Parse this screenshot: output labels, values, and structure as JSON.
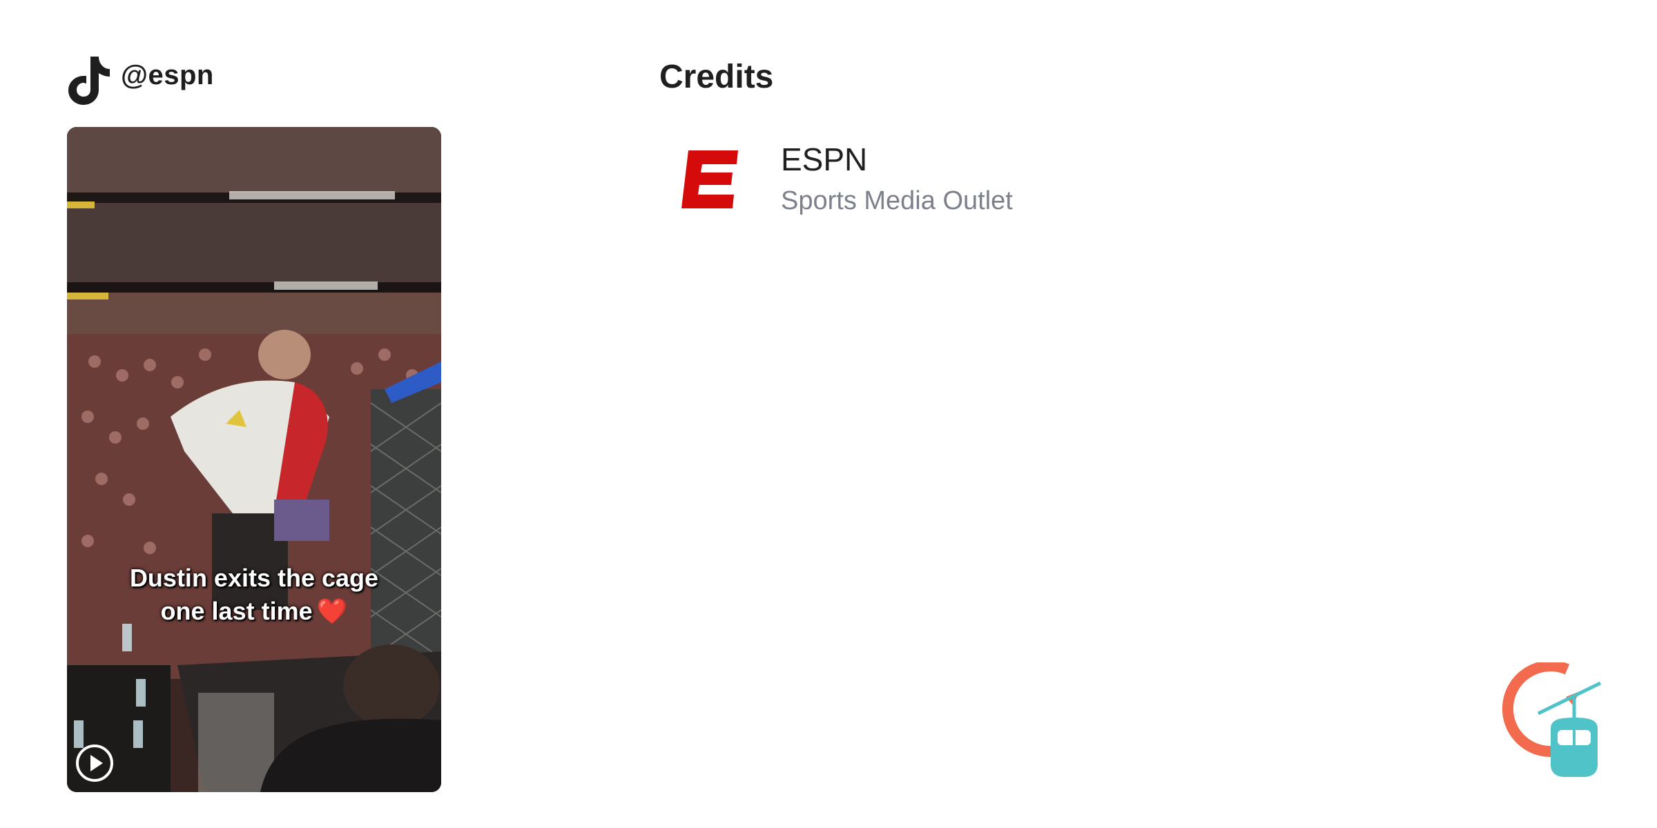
{
  "post": {
    "platform_icon": "tiktok-icon",
    "handle": "@espn",
    "video": {
      "caption_line1": "Dustin exits the cage",
      "caption_line2": "one last time",
      "caption_emoji": "❤️",
      "play_icon": "play-icon"
    }
  },
  "credits": {
    "title": "Credits",
    "items": [
      {
        "name": "ESPN",
        "subtitle": "Sports Media Outlet",
        "logo_icon": "espn-logo",
        "logo_color": "#d50a0a"
      }
    ]
  },
  "brand": {
    "icon": "gondola-logo-icon",
    "colors": {
      "arc": "#f26b4f",
      "cabin": "#4fc3c8"
    }
  }
}
